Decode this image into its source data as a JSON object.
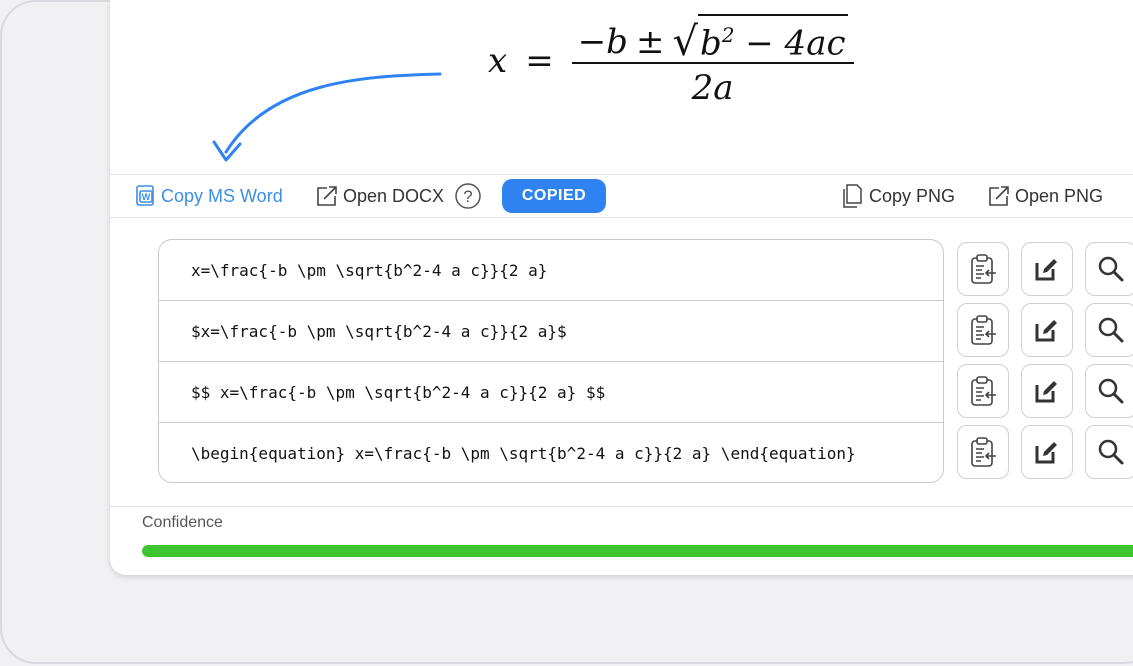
{
  "formula": {
    "lhs": "x",
    "eq": "=",
    "num_neg_b": "−b",
    "pm": "±",
    "radicand_b": "b",
    "radicand_exp": "2",
    "radicand_rest": " − 4ac",
    "denominator": "2a"
  },
  "toolbar": {
    "copy_word": "Copy MS Word",
    "open_docx": "Open DOCX",
    "copied_badge": "COPIED",
    "copy_png": "Copy PNG",
    "open_png": "Open PNG"
  },
  "latex_rows": [
    "x=\\frac{-b \\pm \\sqrt{b^2-4 a c}}{2 a}",
    "$x=\\frac{-b \\pm \\sqrt{b^2-4 a c}}{2 a}$",
    "$$ x=\\frac{-b \\pm \\sqrt{b^2-4 a c}}{2 a} $$",
    "\\begin{equation} x=\\frac{-b \\pm \\sqrt{b^2-4 a c}}{2 a} \\end{equation}"
  ],
  "row_action_icons": [
    "clipboard-paste-icon",
    "edit-icon",
    "search-icon"
  ],
  "confidence": {
    "label": "Confidence",
    "value": 1.0
  },
  "colors": {
    "accent": "#2f83f0",
    "word_link": "#3c8ee6",
    "confidence": "#3dc42f"
  }
}
